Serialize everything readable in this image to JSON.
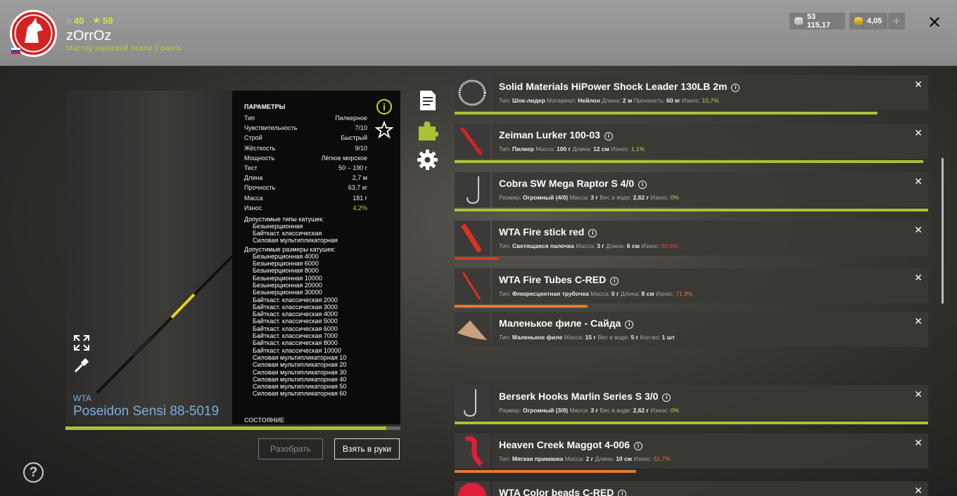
{
  "header": {
    "stat_points": "40",
    "stat_stars": "59",
    "username": "zOrrOz",
    "rank": "Мастер карповой ловли 2 ранга",
    "silver": "53 115,17",
    "gold": "4,05",
    "plus_label": "+",
    "close_label": "✕"
  },
  "rod": {
    "brand": "WTA",
    "name": "Poseidon Sensi 88-5019",
    "durability_fraction": 0.958
  },
  "params": {
    "title": "ПАРАМЕТРЫ",
    "rows": [
      {
        "label": "Тип",
        "value": "Пилкерное"
      },
      {
        "label": "Чувствительность",
        "value": "7/10"
      },
      {
        "label": "Строй",
        "value": "Быстрый"
      },
      {
        "label": "Жёсткость",
        "value": "9/10"
      },
      {
        "label": "Мощность",
        "value": "Лёгкое морское"
      },
      {
        "label": "Тест",
        "value": "50 – 190 г"
      },
      {
        "label": "Длина",
        "value": "2,7 м"
      },
      {
        "label": "Прочность",
        "value": "63,7 кг"
      },
      {
        "label": "Масса",
        "value": "181 г"
      },
      {
        "label": "Износ",
        "value": "4,2%"
      }
    ],
    "reel_types_title": "Допустимые типы катушек:",
    "reel_types": [
      "Безынерционная",
      "Байткаст. классическая",
      "Силовая мультипликаторная"
    ],
    "reel_sizes_title": "Допустимые размеры катушек:",
    "reel_sizes": [
      "Безынерционная 4000",
      "Безынерционная 6000",
      "Безынерционная 8000",
      "Безынерционная 10000",
      "Безынерционная 20000",
      "Безынерционная 30000",
      "Байткаст. классическая 2000",
      "Байткаст. классическая 3000",
      "Байткаст. классическая 4000",
      "Байткаст. классическая 5000",
      "Байткаст. классическая 6000",
      "Байткаст. классическая 7000",
      "Байткаст. классическая 8000",
      "Байткаст. классическая 10000",
      "Силовая мультипликаторная 10",
      "Силовая мультипликаторная 20",
      "Силовая мультипликаторная 30",
      "Силовая мультипликаторная 40",
      "Силовая мультипликаторная 50",
      "Силовая мультипликаторная 60"
    ],
    "state_title": "СОСТОЯНИЕ"
  },
  "buttons": {
    "disassemble": "Разобрать",
    "take": "Взять в руки",
    "help": "?"
  },
  "tackle": [
    {
      "name": "Solid Materials HiPower Shock Leader 130LB 2m",
      "desc": [
        [
          "Тип:",
          "Шок-лидер"
        ],
        [
          "Материал:",
          "Нейлон"
        ],
        [
          "Длина:",
          "2 м"
        ],
        [
          "Прочность:",
          "60 кг"
        ]
      ],
      "wear_label": "Износ:",
      "wear": "10,7%",
      "wear_class": "w-good",
      "bar_fraction": 0.893,
      "bar_color": "#a8c336"
    },
    {
      "name": "Zeiman Lurker 100-03",
      "desc": [
        [
          "Тип:",
          "Пилкер"
        ],
        [
          "Масса:",
          "100 г"
        ],
        [
          "Длина:",
          "12 см"
        ]
      ],
      "wear_label": "Износ:",
      "wear": "1,1%",
      "wear_class": "w-good",
      "bar_fraction": 0.989,
      "bar_color": "#a8c336"
    },
    {
      "name": "Cobra SW Mega Raptor S 4/0",
      "desc": [
        [
          "Размер:",
          "Огромный (4/0)"
        ],
        [
          "Масса:",
          "3 г"
        ],
        [
          "Вес в воде:",
          "2,62 г"
        ]
      ],
      "wear_label": "Износ:",
      "wear": "0%",
      "wear_class": "w-good",
      "bar_fraction": 1.0,
      "bar_color": "#a8c336"
    },
    {
      "name": "WTA Fire stick red",
      "desc": [
        [
          "Тип:",
          "Светящаяся палочка"
        ],
        [
          "Масса:",
          "3 г"
        ],
        [
          "Длина:",
          "6 см"
        ]
      ],
      "wear_label": "Износ:",
      "wear": "90,6%",
      "wear_class": "w-bad",
      "bar_fraction": 0.094,
      "bar_color": "#d63a1e"
    },
    {
      "name": "WTA Fire Tubes C-RED",
      "desc": [
        [
          "Тип:",
          "Флюресцентная трубочка"
        ],
        [
          "Масса:",
          "0 г"
        ],
        [
          "Длина:",
          "8 см"
        ]
      ],
      "wear_label": "Износ:",
      "wear": "71,9%",
      "wear_class": "w-mid",
      "bar_fraction": 0.281,
      "bar_color": "#e8782a"
    },
    {
      "name": "Маленькое филе - Сайда",
      "desc": [
        [
          "Тип:",
          "Маленькое филе"
        ],
        [
          "Масса:",
          "15 г"
        ],
        [
          "Вес в воде:",
          "5 г"
        ],
        [
          "Кол-во:",
          "1 шт"
        ]
      ],
      "wear_label": "",
      "wear": "",
      "wear_class": "",
      "bar_fraction": 0,
      "bar_color": "transparent"
    },
    {
      "name": "Berserk Hooks Marlin Series S 3/0",
      "desc": [
        [
          "Размер:",
          "Огромный (3/0)"
        ],
        [
          "Масса:",
          "3 г"
        ],
        [
          "Вес в воде:",
          "2,62 г"
        ]
      ],
      "wear_label": "Износ:",
      "wear": "0%",
      "wear_class": "w-good",
      "bar_fraction": 1.0,
      "bar_color": "#a8c336"
    },
    {
      "name": "Heaven Creek Maggot 4-006",
      "desc": [
        [
          "Тип:",
          "Мягкая приманка"
        ],
        [
          "Масса:",
          "2 г"
        ],
        [
          "Длина:",
          "10 см"
        ]
      ],
      "wear_label": "Износ:",
      "wear": "61,7%",
      "wear_class": "w-mid",
      "bar_fraction": 0.383,
      "bar_color": "#e8782a"
    },
    {
      "name": "WTA Color beads C-RED",
      "desc": [],
      "wear_label": "",
      "wear": "",
      "wear_class": "",
      "bar_fraction": 0,
      "bar_color": "transparent"
    }
  ],
  "colors": {
    "accent": "#a8c336",
    "danger": "#d63a1e",
    "warning": "#e8782a",
    "rod_text": "#7ab0e0"
  }
}
